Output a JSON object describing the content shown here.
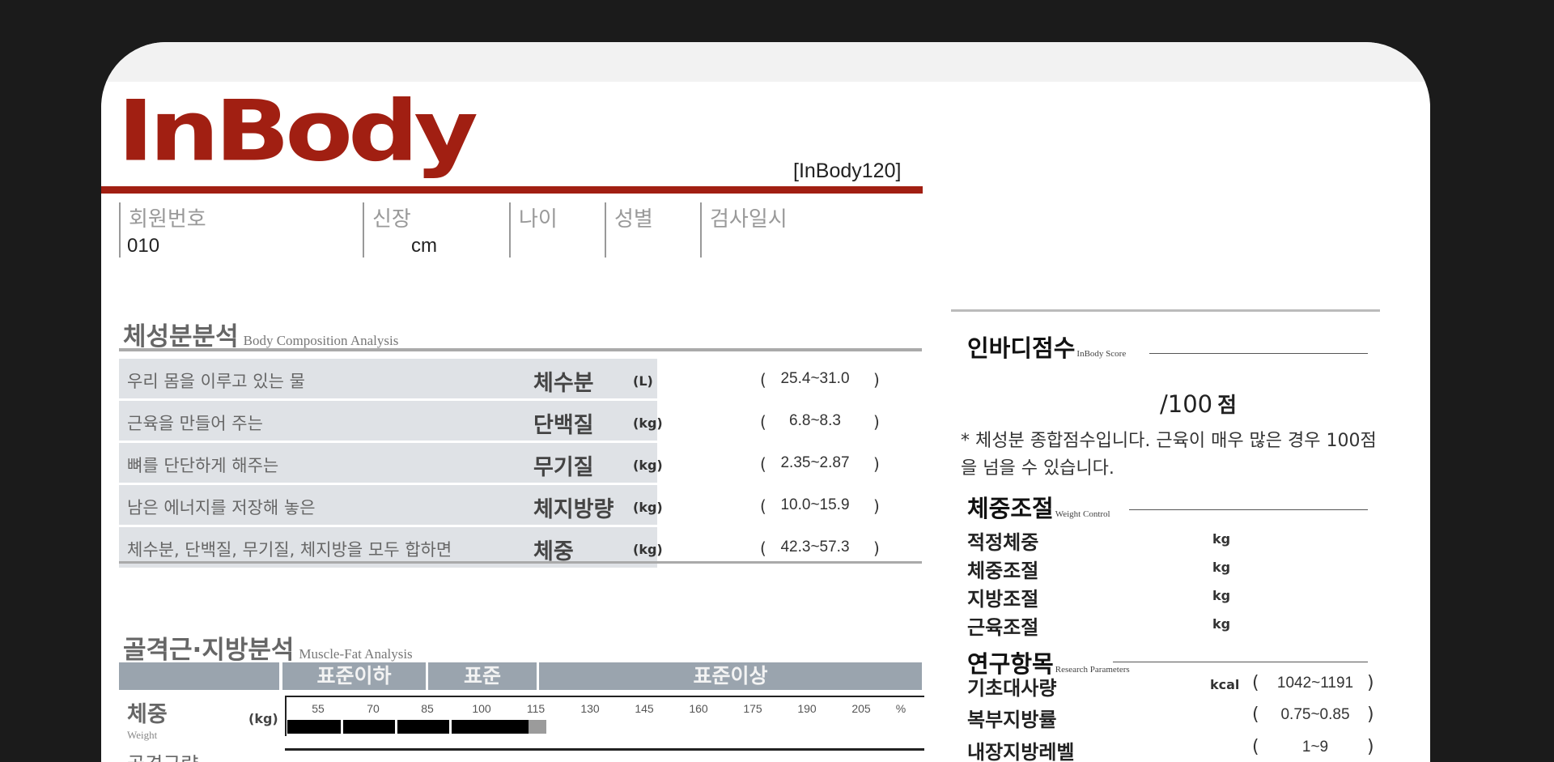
{
  "header": {
    "logo": "InBody",
    "model": "[InBody120]"
  },
  "info": {
    "member_no_label": "회원번호",
    "member_no_value": "010",
    "height_label": "신장",
    "height_unit": "cm",
    "age_label": "나이",
    "sex_label": "성별",
    "date_label": "검사일시"
  },
  "bca": {
    "title": "체성분분석",
    "title_en": "Body Composition Analysis",
    "rows": [
      {
        "desc": "우리 몸을 이루고 있는 물",
        "name": "체수분",
        "unit": "(L)",
        "range": "25.4~31.0"
      },
      {
        "desc": "근육을 만들어 주는",
        "name": "단백질",
        "unit": "(kg)",
        "range": "6.8~8.3"
      },
      {
        "desc": "뼈를 단단하게 해주는",
        "name": "무기질",
        "unit": "(kg)",
        "range": "2.35~2.87"
      },
      {
        "desc": "남은 에너지를 저장해 놓은",
        "name": "체지방량",
        "unit": "(kg)",
        "range": "10.0~15.9"
      },
      {
        "desc": "체수분, 단백질, 무기질, 체지방을 모두 합하면",
        "name": "체중",
        "unit": "(kg)",
        "range": "42.3~57.3"
      }
    ],
    "paren_open": "(",
    "paren_close": ")"
  },
  "mfa": {
    "title": "골격근·지방분석",
    "title_en": "Muscle-Fat Analysis",
    "header_below": "표준이하",
    "header_std": "표준",
    "header_above": "표준이상",
    "row_label": "체중",
    "row_sub": "Weight",
    "row_unit": "(kg)",
    "ticks": [
      "55",
      "70",
      "85",
      "100",
      "115",
      "130",
      "145",
      "160",
      "175",
      "190",
      "205",
      "%"
    ],
    "next_row_label": "골격근량"
  },
  "score": {
    "title": "인바디점수",
    "title_en": "InBody Score",
    "value": "/100",
    "suffix": "점",
    "note": "* 체성분 종합점수입니다. 근육이 매우 많은 경우 100점을 넘을 수 있습니다."
  },
  "weight_control": {
    "title": "체중조절",
    "title_en": "Weight Control",
    "items": [
      {
        "label": "적정체중",
        "unit": "kg"
      },
      {
        "label": "체중조절",
        "unit": "kg"
      },
      {
        "label": "지방조절",
        "unit": "kg"
      },
      {
        "label": "근육조절",
        "unit": "kg"
      }
    ]
  },
  "research": {
    "title": "연구항목",
    "title_en": "Research Parameters",
    "items": [
      {
        "label": "기초대사량",
        "unit": "kcal",
        "range": "1042~1191"
      },
      {
        "label": "복부지방률",
        "unit": "",
        "range": "0.75~0.85"
      },
      {
        "label": "내장지방레벨",
        "unit": "",
        "range": "1~9"
      }
    ]
  },
  "colors": {
    "brand_red": "#a11f12",
    "header_gray": "#9aa4ae",
    "row_shade": "#dfe2e6",
    "background": "#1b1b1b"
  }
}
